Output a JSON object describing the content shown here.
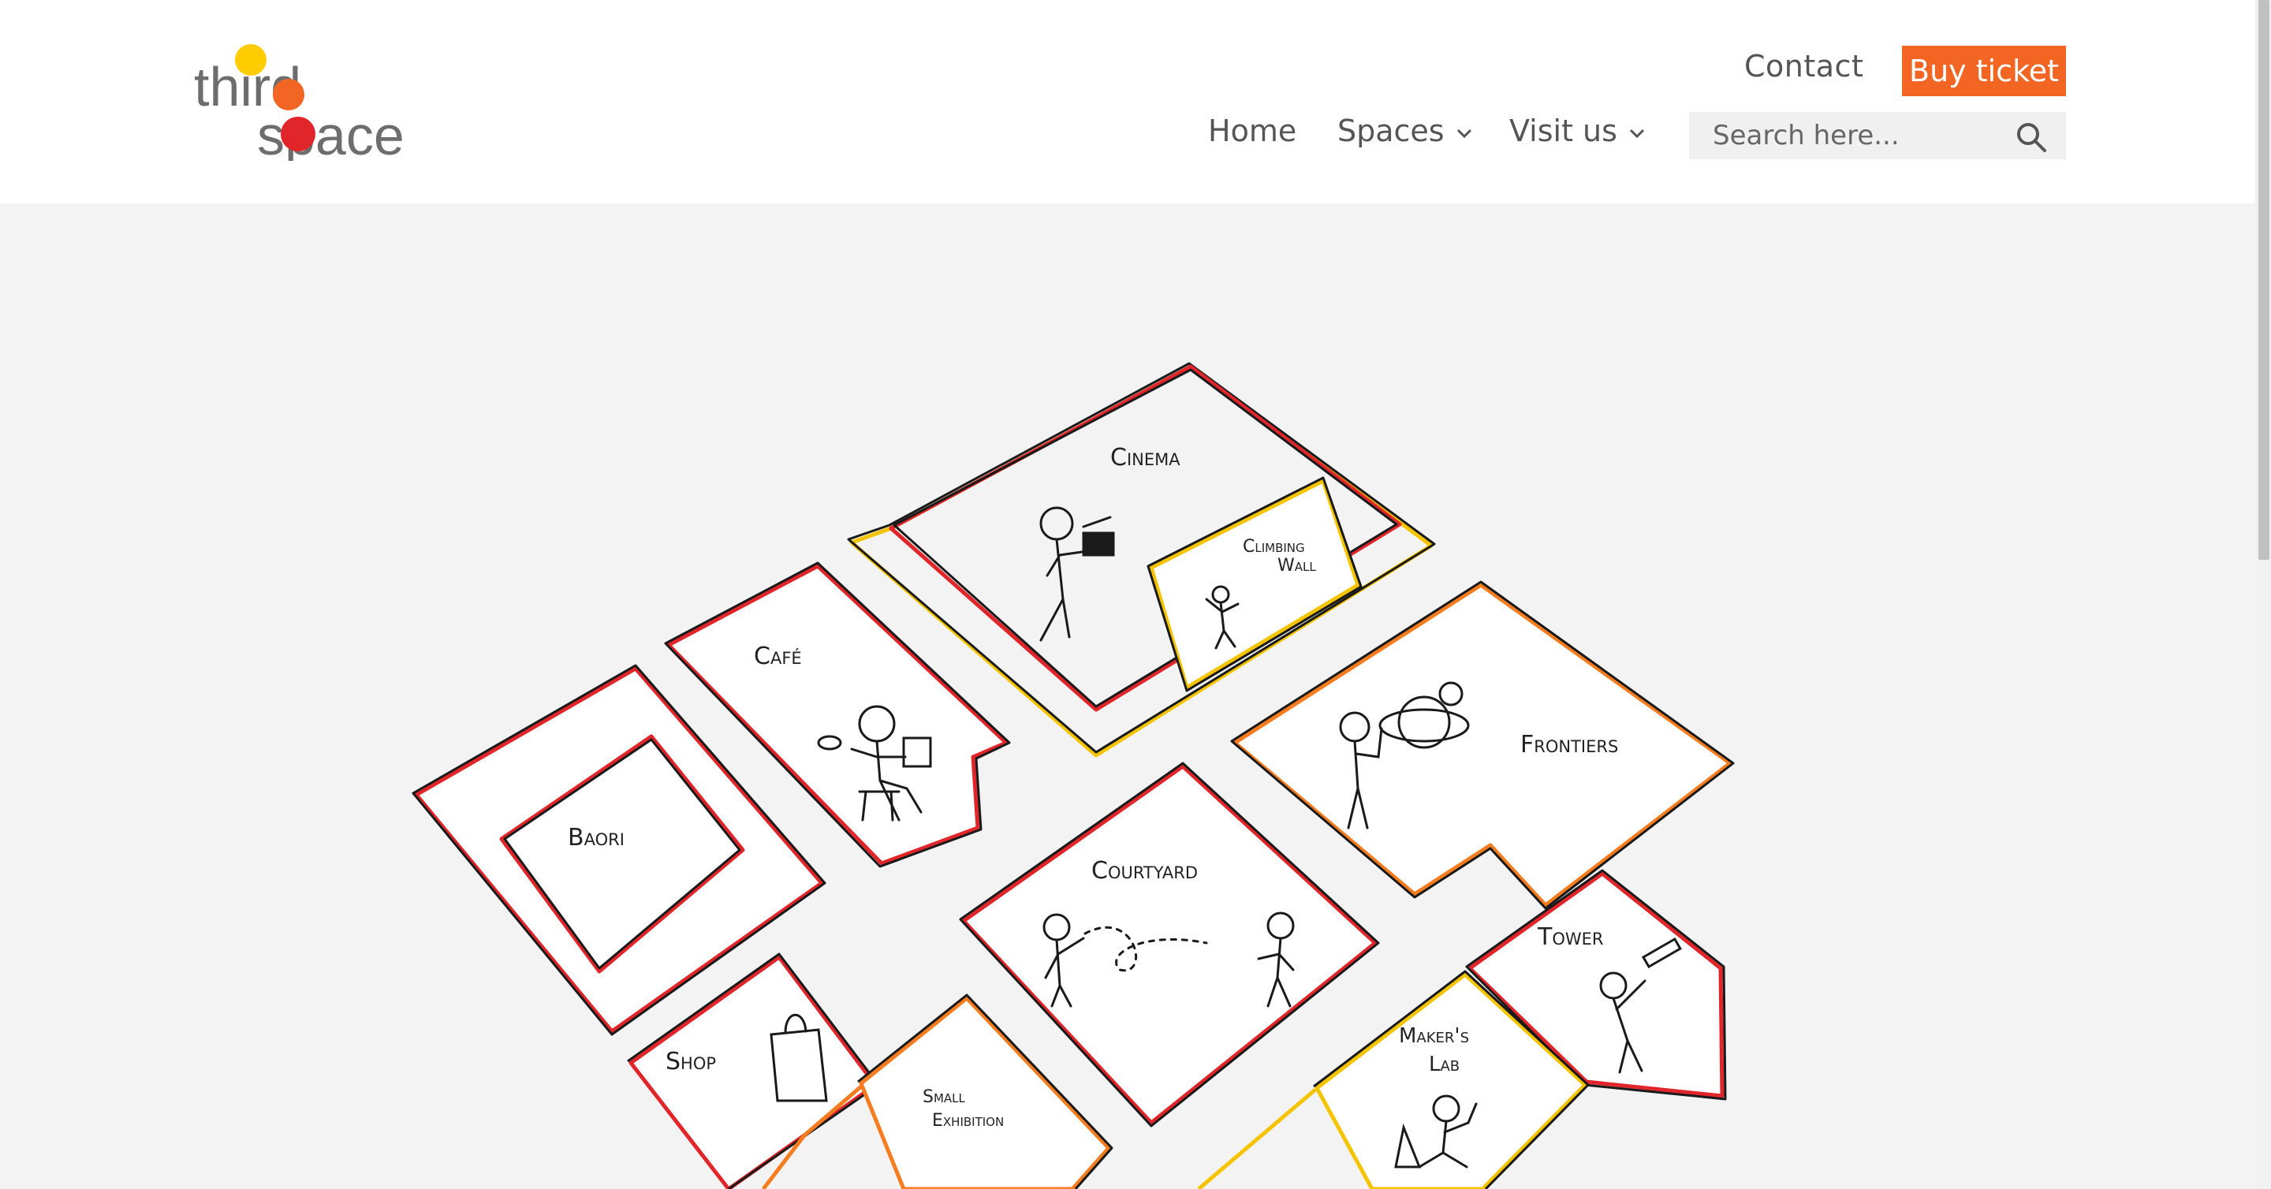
{
  "brand": {
    "logo_text_top": "third",
    "logo_text_bottom": "space",
    "colors": {
      "yellow": "#ffcc00",
      "orange": "#f26522",
      "red": "#e0262a",
      "grey": "#6d6d6d"
    }
  },
  "header": {
    "contact_label": "Contact",
    "buy_label": "Buy ticket",
    "nav": [
      {
        "label": "Home",
        "has_dropdown": false
      },
      {
        "label": "Spaces",
        "has_dropdown": true
      },
      {
        "label": "Visit us",
        "has_dropdown": true
      }
    ],
    "search_placeholder": "Search here...",
    "search_icon": "search-icon"
  },
  "map": {
    "spaces": {
      "cinema": "Cinema",
      "climbing": "Climbing",
      "wall": "Wall",
      "cafe": "Café",
      "baori": "Baori",
      "frontiers": "Frontiers",
      "courtyard": "Courtyard",
      "tower": "Tower",
      "makers": "Maker's",
      "lab": "Lab",
      "shop": "Shop",
      "small": "Small",
      "exhibition": "Exhibition"
    },
    "colors": {
      "red": "#e0262a",
      "yellow": "#f5c400",
      "orange": "#f57c1f",
      "ink": "#1a1a1a"
    }
  }
}
